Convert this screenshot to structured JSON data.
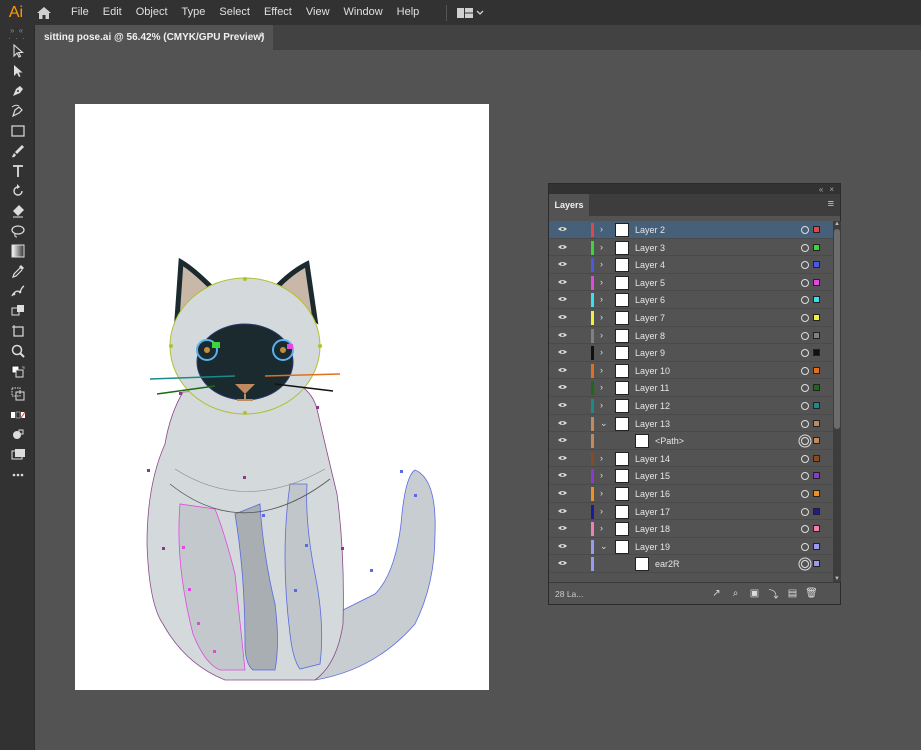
{
  "app": {
    "logo": "Ai",
    "brand_color": "#ff9a00"
  },
  "menu": [
    "File",
    "Edit",
    "Object",
    "Type",
    "Select",
    "Effect",
    "View",
    "Window",
    "Help"
  ],
  "document_tab": {
    "title": "sitting pose.ai @ 56.42% (CMYK/GPU Preview)",
    "close": "×"
  },
  "tools": [
    "selection-tool",
    "direct-selection-tool",
    "pen-tool",
    "curvature-tool",
    "rectangle-tool",
    "paintbrush-tool",
    "type-tool",
    "rotate-tool",
    "eraser-tool",
    "lasso-tool",
    "gradient-tool",
    "eyedropper-tool",
    "puppet-warp-tool",
    "shape-builder-tool",
    "artboard-tool",
    "zoom-tool"
  ],
  "layers_panel": {
    "tab_label": "Layers",
    "count_label": "28 La...",
    "rows": [
      {
        "name": "Layer 2",
        "color": "#e04848",
        "selected": true,
        "expanded": false,
        "indent": false
      },
      {
        "name": "Layer 3",
        "color": "#3ad63a",
        "selected": false,
        "expanded": false,
        "indent": false
      },
      {
        "name": "Layer 4",
        "color": "#4a5ae0",
        "selected": false,
        "expanded": false,
        "indent": false
      },
      {
        "name": "Layer 5",
        "color": "#e048e0",
        "selected": false,
        "expanded": false,
        "indent": false
      },
      {
        "name": "Layer 6",
        "color": "#38e0f0",
        "selected": false,
        "expanded": false,
        "indent": false
      },
      {
        "name": "Layer 7",
        "color": "#f0f040",
        "selected": false,
        "expanded": false,
        "indent": false
      },
      {
        "name": "Layer 8",
        "color": "#808080",
        "selected": false,
        "expanded": false,
        "indent": false
      },
      {
        "name": "Layer 9",
        "color": "#111111",
        "selected": false,
        "expanded": false,
        "indent": false
      },
      {
        "name": "Layer 10",
        "color": "#e07020",
        "selected": false,
        "expanded": false,
        "indent": false
      },
      {
        "name": "Layer 11",
        "color": "#1a6a1a",
        "selected": false,
        "expanded": false,
        "indent": false
      },
      {
        "name": "Layer 12",
        "color": "#1a8a8a",
        "selected": false,
        "expanded": false,
        "indent": false
      },
      {
        "name": "Layer 13",
        "color": "#c08a60",
        "selected": false,
        "expanded": true,
        "indent": false
      },
      {
        "name": "<Path>",
        "color": "#c08a60",
        "selected": false,
        "expanded": false,
        "indent": true
      },
      {
        "name": "Layer 14",
        "color": "#8a4a20",
        "selected": false,
        "expanded": false,
        "indent": false
      },
      {
        "name": "Layer 15",
        "color": "#8a3ad0",
        "selected": false,
        "expanded": false,
        "indent": false
      },
      {
        "name": "Layer 16",
        "color": "#f09020",
        "selected": false,
        "expanded": false,
        "indent": false
      },
      {
        "name": "Layer 17",
        "color": "#1a1a9a",
        "selected": false,
        "expanded": false,
        "indent": false
      },
      {
        "name": "Layer 18",
        "color": "#f080b0",
        "selected": false,
        "expanded": false,
        "indent": false
      },
      {
        "name": "Layer 19",
        "color": "#9a9af0",
        "selected": false,
        "expanded": true,
        "indent": false
      },
      {
        "name": "ear2R",
        "color": "#9a9af0",
        "selected": false,
        "expanded": false,
        "indent": true
      }
    ]
  }
}
